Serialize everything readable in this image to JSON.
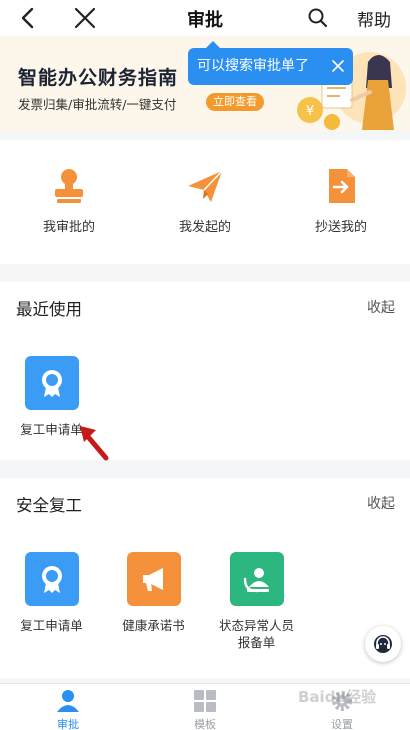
{
  "header": {
    "title": "审批",
    "help_label": "帮助"
  },
  "banner": {
    "title": "智能办公财务指南",
    "subtitle": "发票归集/审批流转/一键支付",
    "cta_label": "立即查看"
  },
  "tooltip": {
    "text": "可以搜索审批单了"
  },
  "quick_actions": [
    {
      "label": "我审批的",
      "icon": "stamp-icon"
    },
    {
      "label": "我发起的",
      "icon": "paper-plane-icon"
    },
    {
      "label": "抄送我的",
      "icon": "cc-document-icon"
    }
  ],
  "recent": {
    "title": "最近使用",
    "fold_label": "收起",
    "apps": [
      {
        "label": "复工申请单",
        "icon": "badge-icon",
        "color": "#3a9cf5"
      }
    ]
  },
  "safe_return": {
    "title": "安全复工",
    "fold_label": "收起",
    "apps": [
      {
        "label": "复工申请单",
        "icon": "badge-icon",
        "color": "#3a9cf5"
      },
      {
        "label": "健康承诺书",
        "icon": "megaphone-icon",
        "color": "#f5913a"
      },
      {
        "label": "状态异常人员报备单",
        "icon": "person-report-icon",
        "color": "#2cb680"
      }
    ]
  },
  "tabs": [
    {
      "label": "审批",
      "icon": "person-icon",
      "active": true
    },
    {
      "label": "模板",
      "icon": "grid-icon",
      "active": false
    },
    {
      "label": "设置",
      "icon": "gear-icon",
      "active": false
    }
  ],
  "watermark": "Baidu经验",
  "colors": {
    "accent": "#2a8ff0",
    "orange": "#f5913a",
    "background": "#f5f6f7"
  }
}
